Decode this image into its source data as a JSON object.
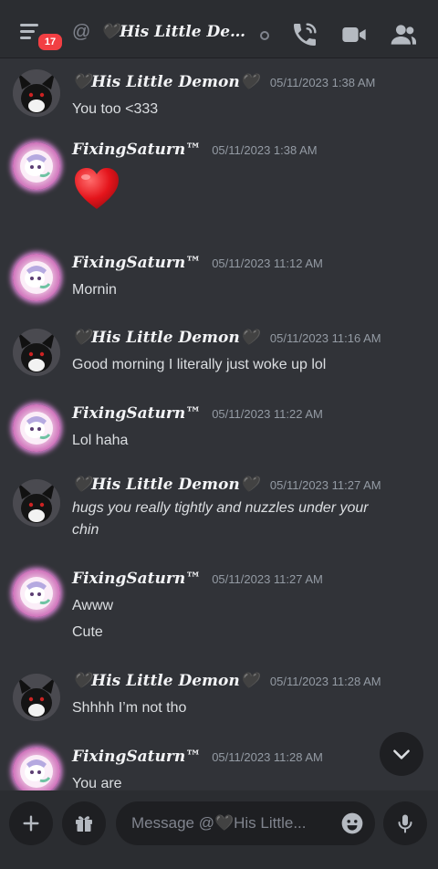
{
  "header": {
    "unread_count": "17",
    "at_symbol": "@",
    "title": "🖤His Little Dem..."
  },
  "messages": [
    {
      "author": "🖤His Little Demon🖤",
      "timestamp": "05/11/2023 1:38 AM",
      "text": "You too <333",
      "avatar": "demon"
    },
    {
      "author": "FixingSaturn™",
      "timestamp": "05/11/2023 1:38 AM",
      "text": "",
      "emoji": "heart",
      "avatar": "saturn"
    },
    {
      "author": "FixingSaturn™",
      "timestamp": "05/11/2023 11:12 AM",
      "text": "Mornin",
      "avatar": "saturn"
    },
    {
      "author": "🖤His Little Demon🖤",
      "timestamp": "05/11/2023 11:16 AM",
      "text": "Good morning I literally just woke up lol",
      "avatar": "demon"
    },
    {
      "author": "FixingSaturn™",
      "timestamp": "05/11/2023 11:22 AM",
      "text": "Lol haha",
      "avatar": "saturn"
    },
    {
      "author": "🖤His Little Demon🖤",
      "timestamp": "05/11/2023 11:27 AM",
      "text_line1": "hugs you really tightly and nuzzles under your",
      "text_line2": "chin",
      "avatar": "demon"
    },
    {
      "author": "FixingSaturn™",
      "timestamp": "05/11/2023 11:27 AM",
      "text": "Awww",
      "text2": "Cute",
      "avatar": "saturn"
    },
    {
      "author": "🖤His Little Demon🖤",
      "timestamp": "05/11/2023 11:28 AM",
      "text": "Shhhh I’m not tho",
      "avatar": "demon"
    },
    {
      "author": "FixingSaturn™",
      "timestamp": "05/11/2023 11:28 AM",
      "text": "You are",
      "avatar": "saturn"
    }
  ],
  "composer": {
    "placeholder": "Message @🖤His Little..."
  },
  "colors": {
    "background": "#313338",
    "header": "#2b2d31",
    "badge": "#f23f43",
    "timestamp": "#949ba4"
  },
  "icons": [
    "hamburger-menu-icon",
    "at-icon",
    "offline-status-icon",
    "phone-call-icon",
    "video-camera-icon",
    "members-icon",
    "plus-icon",
    "gift-icon",
    "emoji-smile-icon",
    "microphone-icon",
    "chevron-down-icon"
  ]
}
